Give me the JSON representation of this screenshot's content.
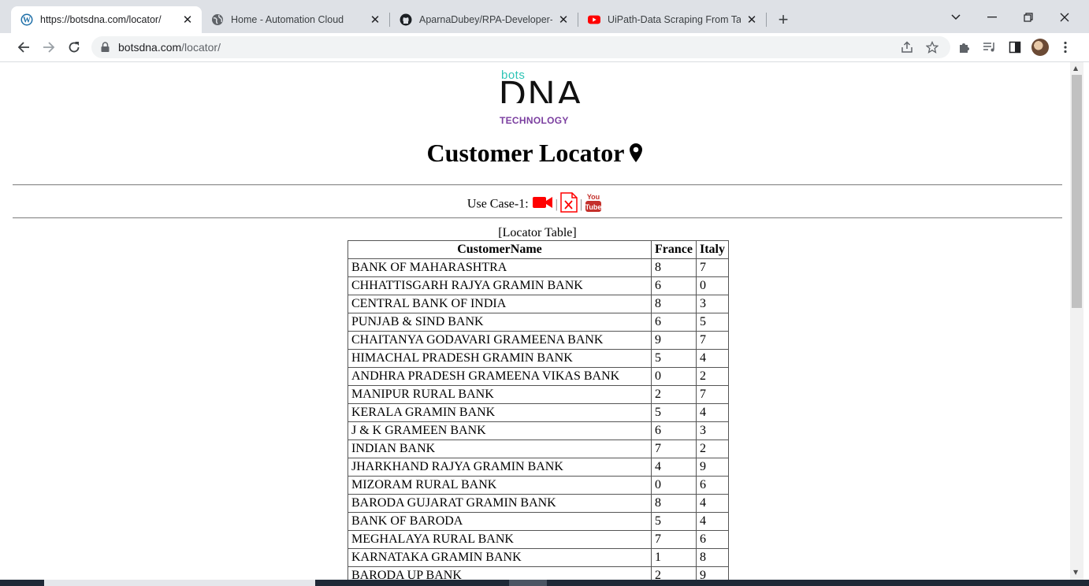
{
  "browser": {
    "tabs": [
      {
        "title": "https://botsdna.com/locator/",
        "icon": "wordpress-icon",
        "active": true
      },
      {
        "title": "Home - Automation Cloud",
        "icon": "globe-icon",
        "active": false
      },
      {
        "title": "AparnaDubey/RPA-Developer-in",
        "icon": "github-icon",
        "active": false
      },
      {
        "title": "UiPath-Data Scraping From Table",
        "icon": "youtube-icon",
        "active": false
      }
    ],
    "new_tab": "+",
    "url_host": "botsdna.com",
    "url_path": "/locator/"
  },
  "page": {
    "logo": {
      "bots": "bots",
      "dna": "DNA",
      "tech": "TECHNOLOGY"
    },
    "title": "Customer Locator",
    "use_case_label": "Use Case-1:",
    "separator": "|",
    "youtube_top": "You",
    "youtube_bottom": "Tube",
    "caption": "[Locator Table]",
    "table": {
      "headers": [
        "CustomerName",
        "France",
        "Italy"
      ],
      "rows": [
        [
          "BANK OF MAHARASHTRA",
          "8",
          "7"
        ],
        [
          "CHHATTISGARH RAJYA GRAMIN BANK",
          "6",
          "0"
        ],
        [
          "CENTRAL BANK OF INDIA",
          "8",
          "3"
        ],
        [
          "PUNJAB & SIND BANK",
          "6",
          "5"
        ],
        [
          "CHAITANYA GODAVARI GRAMEENA BANK",
          "9",
          "7"
        ],
        [
          "HIMACHAL PRADESH GRAMIN BANK",
          "5",
          "4"
        ],
        [
          "ANDHRA PRADESH GRAMEENA VIKAS BANK",
          "0",
          "2"
        ],
        [
          "MANIPUR RURAL BANK",
          "2",
          "7"
        ],
        [
          "KERALA GRAMIN BANK",
          "5",
          "4"
        ],
        [
          "J & K GRAMEEN BANK",
          "6",
          "3"
        ],
        [
          "INDIAN BANK",
          "7",
          "2"
        ],
        [
          "JHARKHAND RAJYA GRAMIN BANK",
          "4",
          "9"
        ],
        [
          "MIZORAM RURAL BANK",
          "0",
          "6"
        ],
        [
          "BARODA GUJARAT GRAMIN BANK",
          "8",
          "4"
        ],
        [
          "BANK OF BARODA",
          "5",
          "4"
        ],
        [
          "MEGHALAYA RURAL BANK",
          "7",
          "6"
        ],
        [
          "KARNATAKA GRAMIN BANK",
          "1",
          "8"
        ],
        [
          "BARODA UP BANK",
          "2",
          "9"
        ]
      ]
    }
  },
  "colors": {
    "accent_red": "#ff0000",
    "logo_teal": "#2ec4b6",
    "logo_purple": "#7b3fa0"
  }
}
